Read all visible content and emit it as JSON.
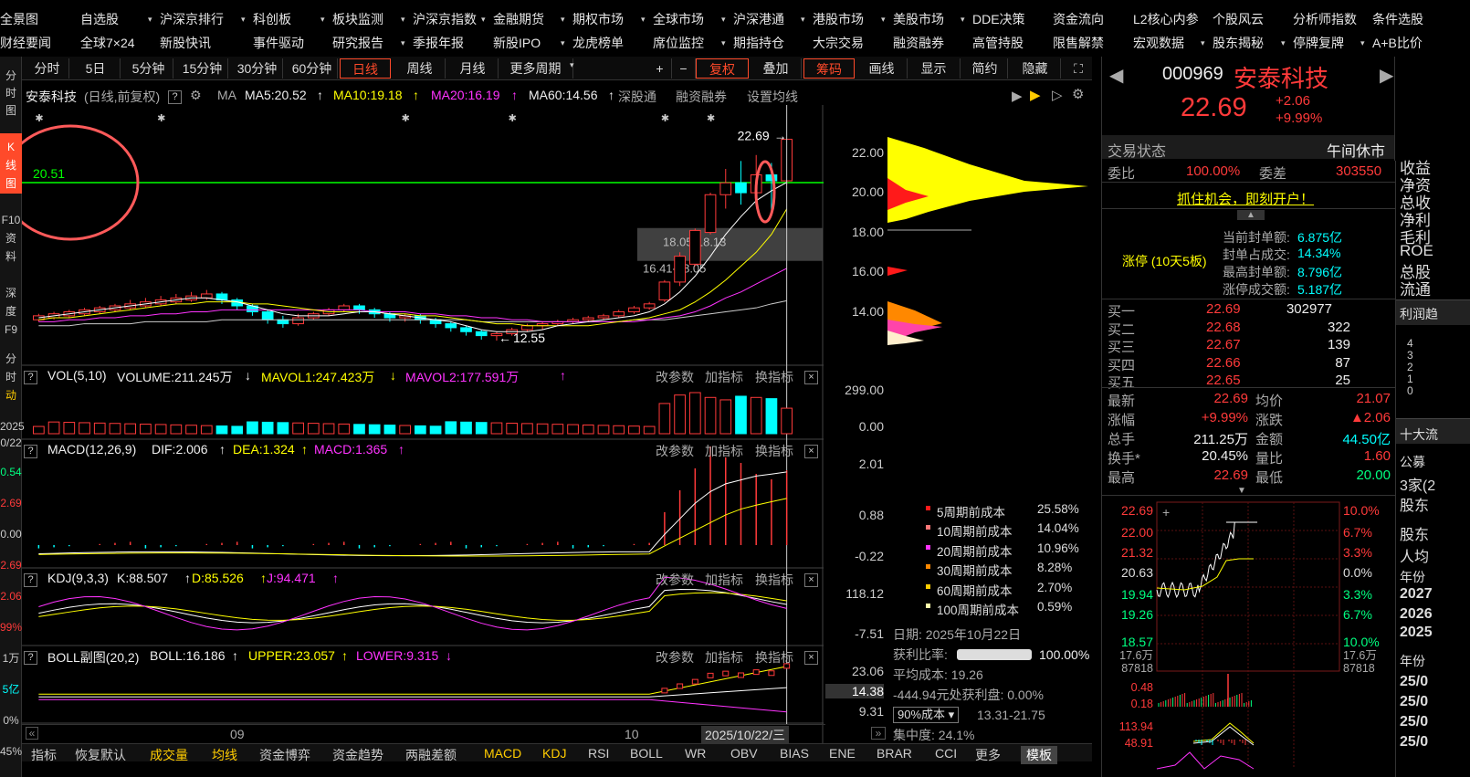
{
  "menu_row1": [
    "全景图",
    "自选股",
    "沪深京排行",
    "科创板",
    "板块监测",
    "沪深京指数",
    "金融期货",
    "期权市场",
    "全球市场",
    "沪深港通",
    "港股市场",
    "美股市场",
    "DDE决策",
    "资金流向",
    "L2核心内参",
    "个股风云",
    "分析师指数",
    "条件选股"
  ],
  "menu_row2": [
    "财经要闻",
    "全球7×24",
    "新股快讯",
    "事件驱动",
    "研究报告",
    "季报年报",
    "新股IPO",
    "龙虎榜单",
    "席位监控",
    "期指持仓",
    "大宗交易",
    "融资融券",
    "高管持股",
    "限售解禁",
    "宏观数据",
    "股东揭秘",
    "停牌复牌",
    "A+B比价"
  ],
  "left_strip": [
    "分",
    "时",
    "图",
    "K",
    "线",
    "图",
    "F10",
    "资",
    "料",
    "深",
    "度",
    "F9",
    "分",
    "时",
    "动",
    "2025",
    "0/22",
    "0.54",
    "2.69",
    "0.00",
    "2.69",
    "2.06",
    "99%",
    "1万",
    "5亿",
    "0%",
    "45%"
  ],
  "toolbar": {
    "periods": [
      "分时",
      "5日",
      "5分钟",
      "15分钟",
      "30分钟",
      "60分钟",
      "日线",
      "周线",
      "月线",
      "更多周期"
    ],
    "active": "日线",
    "ops": [
      "+",
      "−",
      "复权",
      "叠加",
      "筹码",
      "画线",
      "显示",
      "简约",
      "隐藏"
    ]
  },
  "chart_legend": {
    "name": "安泰科技",
    "mode": "(日线,前复权)",
    "ma": "MA",
    "ma5": "MA5:20.52",
    "ma10": "MA10:19.18",
    "ma20": "MA20:16.19",
    "ma60": "MA60:14.56",
    "links": [
      "深股通",
      "融资融券",
      "设置均线"
    ]
  },
  "main_chart": {
    "y_ticks": [
      "22.00",
      "20.00",
      "18.00",
      "16.00",
      "14.00"
    ],
    "y_range": [
      12.0,
      23.5
    ],
    "last_price_label": "22.69",
    "low_label": "12.55",
    "line_label": "20.51",
    "zone1": "18.05-18.13",
    "zone2": "16.41-18.05",
    "candles": [
      [
        13.6,
        13.8,
        13.5,
        13.9
      ],
      [
        13.7,
        13.9,
        13.6,
        14.0
      ],
      [
        13.8,
        14.0,
        13.7,
        14.1
      ],
      [
        13.9,
        14.1,
        13.8,
        14.2
      ],
      [
        14.0,
        14.2,
        13.9,
        14.3
      ],
      [
        14.1,
        14.3,
        14.0,
        14.4
      ],
      [
        14.2,
        14.4,
        14.1,
        14.6
      ],
      [
        14.3,
        14.5,
        14.2,
        14.7
      ],
      [
        14.4,
        14.6,
        14.3,
        14.8
      ],
      [
        14.5,
        14.7,
        14.4,
        14.9
      ],
      [
        14.6,
        14.8,
        14.5,
        15.0
      ],
      [
        14.7,
        14.9,
        14.6,
        15.1
      ],
      [
        14.9,
        14.6,
        14.4,
        15.0
      ],
      [
        14.6,
        14.3,
        14.1,
        14.7
      ],
      [
        14.3,
        14.0,
        13.8,
        14.4
      ],
      [
        14.0,
        13.6,
        13.4,
        14.1
      ],
      [
        13.6,
        13.4,
        13.2,
        13.8
      ],
      [
        13.4,
        13.7,
        13.3,
        13.9
      ],
      [
        13.7,
        13.9,
        13.6,
        14.0
      ],
      [
        13.9,
        14.1,
        13.8,
        14.2
      ],
      [
        14.1,
        14.3,
        14.0,
        14.4
      ],
      [
        14.3,
        14.1,
        13.9,
        14.4
      ],
      [
        14.1,
        13.9,
        13.7,
        14.2
      ],
      [
        13.9,
        13.7,
        13.5,
        14.0
      ],
      [
        13.7,
        13.8,
        13.5,
        13.9
      ],
      [
        13.8,
        13.6,
        13.4,
        13.9
      ],
      [
        13.6,
        13.4,
        13.2,
        13.7
      ],
      [
        13.4,
        13.2,
        13.0,
        13.5
      ],
      [
        13.2,
        13.0,
        12.8,
        13.3
      ],
      [
        13.0,
        12.8,
        12.6,
        13.1
      ],
      [
        12.8,
        12.9,
        12.55,
        13.0
      ],
      [
        12.9,
        13.1,
        12.8,
        13.2
      ],
      [
        13.1,
        13.3,
        13.0,
        13.4
      ],
      [
        13.3,
        13.4,
        13.1,
        13.5
      ],
      [
        13.4,
        13.5,
        13.3,
        13.6
      ],
      [
        13.5,
        13.6,
        13.4,
        13.7
      ],
      [
        13.6,
        13.7,
        13.5,
        13.8
      ],
      [
        13.7,
        13.8,
        13.6,
        13.9
      ],
      [
        13.8,
        14.0,
        13.7,
        14.1
      ],
      [
        14.0,
        14.2,
        13.9,
        14.3
      ],
      [
        14.2,
        14.4,
        14.1,
        14.5
      ],
      [
        14.6,
        15.5,
        14.5,
        15.6
      ],
      [
        15.5,
        16.8,
        15.3,
        17.0
      ],
      [
        16.4,
        18.1,
        16.3,
        18.2
      ],
      [
        18.0,
        19.9,
        17.9,
        20.0
      ],
      [
        19.9,
        20.5,
        19.2,
        21.2
      ],
      [
        20.5,
        20.0,
        19.4,
        21.6
      ],
      [
        20.0,
        20.9,
        19.8,
        21.9
      ],
      [
        20.9,
        20.6,
        19.0,
        21.5
      ],
      [
        20.6,
        22.69,
        20.4,
        22.69
      ]
    ],
    "ma5": [
      13.7,
      13.8,
      13.9,
      14.0,
      14.1,
      14.2,
      14.3,
      14.4,
      14.5,
      14.6,
      14.7,
      14.7,
      14.6,
      14.5,
      14.3,
      14.1,
      13.9,
      13.8,
      13.8,
      13.8,
      13.9,
      14.0,
      14.0,
      13.9,
      13.8,
      13.7,
      13.6,
      13.5,
      13.3,
      13.1,
      13.0,
      13.0,
      13.0,
      13.1,
      13.3,
      13.4,
      13.5,
      13.6,
      13.7,
      13.8,
      14.0,
      14.4,
      15.0,
      15.8,
      16.8,
      17.9,
      18.8,
      19.6,
      20.1,
      20.52
    ],
    "ma10": [
      13.6,
      13.7,
      13.7,
      13.8,
      13.9,
      14.0,
      14.1,
      14.2,
      14.3,
      14.4,
      14.4,
      14.5,
      14.5,
      14.5,
      14.4,
      14.4,
      14.3,
      14.2,
      14.1,
      14.0,
      14.0,
      14.0,
      14.0,
      13.9,
      13.9,
      13.8,
      13.8,
      13.7,
      13.6,
      13.5,
      13.4,
      13.4,
      13.3,
      13.3,
      13.3,
      13.3,
      13.3,
      13.4,
      13.5,
      13.6,
      13.7,
      13.9,
      14.1,
      14.5,
      15.0,
      15.6,
      16.3,
      17.0,
      17.9,
      19.18
    ],
    "ma20": [
      13.5,
      13.5,
      13.6,
      13.6,
      13.7,
      13.7,
      13.8,
      13.8,
      13.9,
      13.9,
      14.0,
      14.0,
      14.1,
      14.1,
      14.1,
      14.1,
      14.1,
      14.1,
      14.1,
      14.1,
      14.1,
      14.1,
      14.0,
      14.0,
      14.0,
      13.9,
      13.9,
      13.8,
      13.8,
      13.7,
      13.7,
      13.6,
      13.6,
      13.5,
      13.5,
      13.5,
      13.5,
      13.5,
      13.5,
      13.5,
      13.6,
      13.7,
      13.8,
      14.0,
      14.3,
      14.7,
      15.0,
      15.4,
      15.8,
      16.19
    ],
    "ma60": [
      13.3,
      13.3,
      13.3,
      13.4,
      13.4,
      13.4,
      13.4,
      13.5,
      13.5,
      13.5,
      13.5,
      13.5,
      13.6,
      13.6,
      13.6,
      13.6,
      13.6,
      13.6,
      13.6,
      13.6,
      13.6,
      13.6,
      13.6,
      13.6,
      13.6,
      13.6,
      13.6,
      13.6,
      13.6,
      13.5,
      13.5,
      13.5,
      13.5,
      13.5,
      13.5,
      13.5,
      13.5,
      13.5,
      13.5,
      13.6,
      13.6,
      13.6,
      13.7,
      13.8,
      13.9,
      14.0,
      14.1,
      14.2,
      14.4,
      14.56
    ]
  },
  "vol_panel": {
    "title": "VOL(5,10)",
    "volume": "VOLUME:211.245万",
    "mavol1": "MAVOL1:247.423万",
    "mavol2": "MAVOL2:177.591万",
    "y_ticks": [
      "299.00",
      "0.00"
    ],
    "ops": [
      "改参数",
      "加指标",
      "换指标"
    ]
  },
  "macd_panel": {
    "title": "MACD(12,26,9)",
    "dif": "DIF:2.006",
    "dea": "DEA:1.324",
    "macd": "MACD:1.365",
    "y_ticks": [
      "2.01",
      "0.88",
      "-0.22"
    ],
    "ops": [
      "改参数",
      "加指标",
      "换指标"
    ]
  },
  "kdj_panel": {
    "title": "KDJ(9,3,3)",
    "k": "K:88.507",
    "d": "D:85.526",
    "j": "J:94.471",
    "y_ticks": [
      "118.12",
      "-7.51"
    ],
    "ops": [
      "改参数",
      "加指标",
      "换指标"
    ]
  },
  "boll_panel": {
    "title": "BOLL副图(20,2)",
    "boll": "BOLL:16.186",
    "upper": "UPPER:23.057",
    "lower": "LOWER:9.315",
    "y_ticks": [
      "23.06",
      "14.38",
      "9.31"
    ],
    "ops": [
      "改参数",
      "加指标",
      "换指标"
    ]
  },
  "x_axis": {
    "labels": [
      "09",
      "10"
    ],
    "cursor_date": "2025/10/22/三"
  },
  "chips": {
    "cost_legend": [
      [
        "5周期前成本",
        "25.58%"
      ],
      [
        "10周期前成本",
        "14.04%"
      ],
      [
        "20周期前成本",
        "10.96%"
      ],
      [
        "30周期前成本",
        "8.28%"
      ],
      [
        "60周期前成本",
        "2.70%"
      ],
      [
        "100周期前成本",
        "0.59%"
      ]
    ],
    "date": "日期: 2025年10月22日",
    "profit_ratio_label": "获利比率:",
    "profit_ratio": "100.00%",
    "avg_cost": "平均成本: 19.26",
    "profit_line": "-444.94元处获利盘: 0.00%",
    "cost_select": "90%成本",
    "cost_range": "13.31-21.75",
    "concentration": "集中度: 24.1%"
  },
  "quote": {
    "code": "000969",
    "name": "安泰科技",
    "price": "22.69",
    "change": "+2.06",
    "pct": "+9.99%",
    "status_label": "交易状态",
    "status": "午间休市",
    "weibi_label": "委比",
    "weibi": "100.00%",
    "weicha_label": "委差",
    "weicha": "303550",
    "promo": "抓住机会，即刻开户！",
    "limit": {
      "title": "涨停 (10天5板)",
      "rows": [
        [
          "当前封单额:",
          "6.875亿"
        ],
        [
          "封单占成交:",
          "14.34%"
        ],
        [
          "最高封单额:",
          "8.796亿"
        ],
        [
          "涨停成交额:",
          "5.187亿"
        ]
      ]
    },
    "bids": [
      [
        "买一",
        "22.69",
        "302977"
      ],
      [
        "买二",
        "22.68",
        "322"
      ],
      [
        "买三",
        "22.67",
        "139"
      ],
      [
        "买四",
        "22.66",
        "87"
      ],
      [
        "买五",
        "22.65",
        "25"
      ]
    ],
    "stats": [
      [
        "最新",
        "22.69",
        "均价",
        "21.07"
      ],
      [
        "涨幅",
        "+9.99%",
        "涨跌",
        "▲2.06"
      ],
      [
        "总手",
        "211.25万",
        "金额",
        "44.50亿"
      ],
      [
        "换手*",
        "20.45%",
        "量比",
        "1.60"
      ],
      [
        "最高",
        "22.69",
        "最低",
        "20.00"
      ]
    ]
  },
  "mini_chart": {
    "left_ticks": [
      "22.69",
      "22.00",
      "21.32",
      "20.63",
      "19.94",
      "19.26",
      "18.57",
      "17.6万",
      "87818",
      "0.48",
      "0.18",
      "113.94",
      "48.91"
    ],
    "right_ticks": [
      "10.0%",
      "6.7%",
      "3.3%",
      "0.0%",
      "3.3%",
      "6.7%",
      "10.0%",
      "17.6万",
      "87818"
    ]
  },
  "far_right": {
    "top_labels": [
      "收益",
      "净资",
      "总收",
      "净利",
      "毛利",
      "ROE",
      "总股",
      "流通"
    ],
    "section": "利润趋",
    "nums": [
      "4",
      "3",
      "2",
      "1",
      "0"
    ],
    "section2": "十大流",
    "rows": [
      "公募",
      "3家(2",
      "股东",
      "股东",
      "人均",
      "年份",
      "2027",
      "2026",
      "2025",
      "年份",
      "25/0",
      "25/0",
      "25/0",
      "25/0"
    ]
  },
  "bottom_tabs": [
    "指标",
    "恢复默认",
    "成交量",
    "均线",
    "资金博弈",
    "资金趋势",
    "两融差额",
    "MACD",
    "KDJ",
    "RSI",
    "BOLL",
    "WR",
    "OBV",
    "BIAS",
    "ENE",
    "BRAR",
    "CCI",
    "更多",
    "模板"
  ],
  "colors": {
    "up": "#ff3a3a",
    "down": "#00ffff",
    "ma5": "#ffffff",
    "ma10": "#ffff00",
    "ma20": "#ff33ff",
    "ma60": "#cccccc",
    "accent": "#ff4a2a"
  }
}
